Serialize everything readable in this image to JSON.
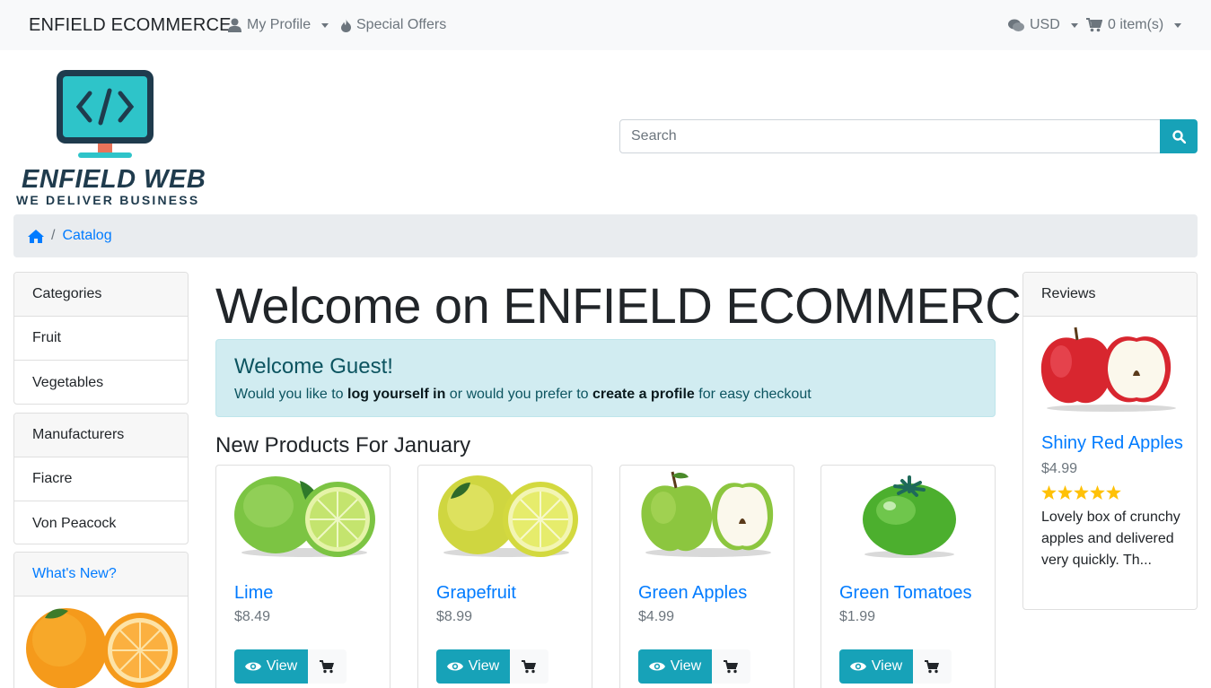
{
  "nav": {
    "brand": "ENFIELD ECOMMERCE",
    "my_profile": "My Profile",
    "special_offers": "Special Offers",
    "currency": "USD",
    "cart": "0 item(s)"
  },
  "logo": {
    "title": "ENFIELD WEB",
    "tagline": "WE DELIVER BUSINESS"
  },
  "search": {
    "placeholder": "Search"
  },
  "breadcrumb": {
    "current": "Catalog"
  },
  "sidebar": {
    "categories": {
      "header": "Categories",
      "items": [
        "Fruit",
        "Vegetables"
      ]
    },
    "manufacturers": {
      "header": "Manufacturers",
      "items": [
        "Fiacre",
        "Von Peacock"
      ]
    },
    "whats_new": {
      "header": "What's New?"
    }
  },
  "main": {
    "title": "Welcome on ENFIELD ECOMMERCE",
    "alert": {
      "title": "Welcome Guest!",
      "text_1": "Would you like to ",
      "link_login": "log yourself in",
      "text_2": " or would you prefer to ",
      "link_profile": "create a profile",
      "text_3": " for easy checkout"
    },
    "section_title": "New Products For January",
    "products": [
      {
        "name": "Lime",
        "price": "$8.49",
        "view_label": "View"
      },
      {
        "name": "Grapefruit",
        "price": "$8.99",
        "view_label": "View"
      },
      {
        "name": "Green Apples",
        "price": "$4.99",
        "view_label": "View"
      },
      {
        "name": "Green Tomatoes",
        "price": "$1.99",
        "view_label": "View"
      }
    ]
  },
  "reviews": {
    "header": "Reviews",
    "product_name": "Shiny Red Apples",
    "price": "$4.99",
    "rating": 5,
    "text": "Lovely box of crunchy apples and delivered very quickly. Th..."
  },
  "colors": {
    "link": "#007bff",
    "info": "#17a2b8",
    "star": "#ffc107",
    "alert_bg": "#d1ecf1"
  }
}
